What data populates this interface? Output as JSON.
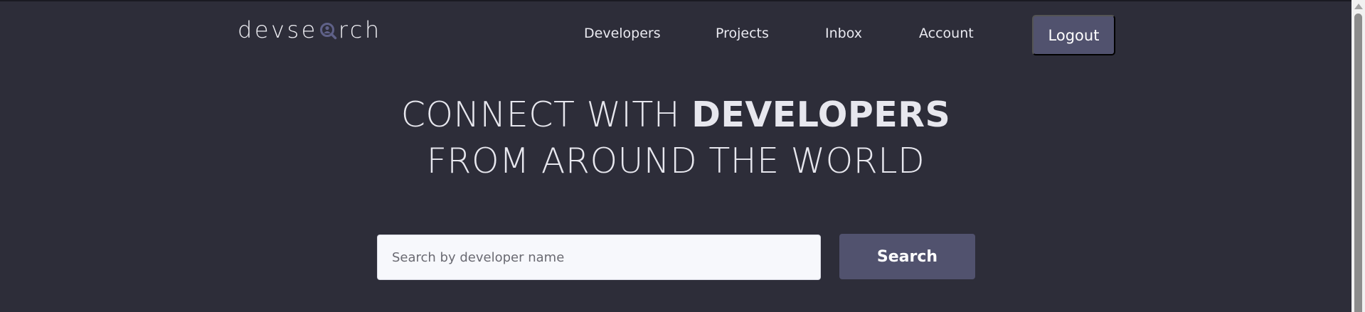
{
  "brand": {
    "logo_prefix": "devse",
    "logo_suffix": "rch",
    "logo_icon": "magnifier-user-icon"
  },
  "nav": {
    "items": [
      {
        "label": "Developers"
      },
      {
        "label": "Projects"
      },
      {
        "label": "Inbox"
      },
      {
        "label": "Account"
      }
    ],
    "logout_label": "Logout"
  },
  "hero": {
    "line1_light": "CONNECT WITH ",
    "line1_bold": "DEVELOPERS",
    "line2": "FROM AROUND THE WORLD"
  },
  "search": {
    "placeholder": "Search by developer name",
    "value": "",
    "button_label": "Search"
  },
  "colors": {
    "background": "#2d2d39",
    "accent": "#51526e",
    "input_bg": "#f7f8fc",
    "text": "#e9e9f0"
  }
}
